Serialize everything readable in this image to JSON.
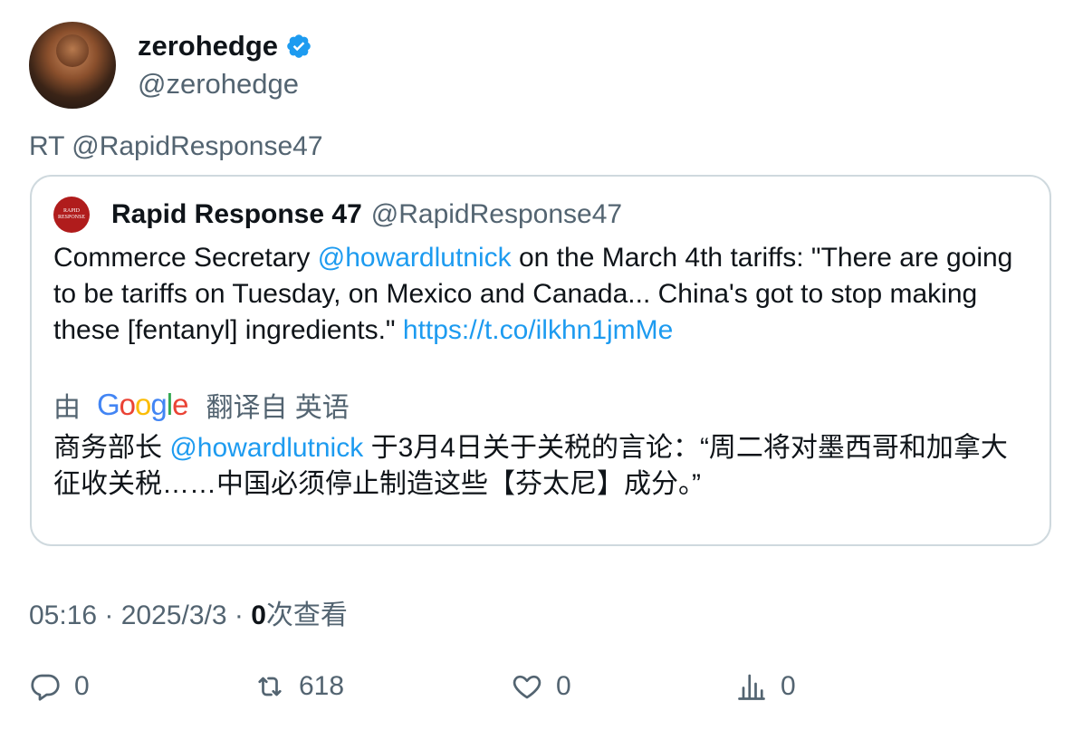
{
  "author": {
    "display_name": "zerohedge",
    "handle": "@zerohedge",
    "verified_icon": "verified-badge-icon"
  },
  "retweet_prefix": "RT @RapidResponse47",
  "quote": {
    "name": "Rapid Response 47",
    "handle": "@RapidResponse47",
    "avatar_text": "RAPID RESPONSE",
    "text_before_mention": "Commerce Secretary ",
    "mention": "@howardlutnick",
    "text_after_mention": " on the March 4th tariffs: \"There are going to be tariffs on Tuesday, on Mexico and Canada... China's got to stop making these [fentanyl] ingredients.\" ",
    "url": "https://t.co/ilkhn1jmMe",
    "translation": {
      "by_label": "由",
      "provider": "Google",
      "translated_from_label": "翻译自 英语",
      "text_before_mention": "商务部长 ",
      "mention": "@howardlutnick",
      "text_after_mention": " 于3月4日关于关税的言论：“周二将对墨西哥和加拿大征收关税……中国必须停止制造这些【芬太尼】成分。”"
    }
  },
  "meta": {
    "time": "05:16",
    "separator": " · ",
    "date": "2025/3/3",
    "views_count": "0",
    "views_label": "次查看"
  },
  "actions": {
    "replies": "0",
    "retweets": "618",
    "likes": "0",
    "views": "0"
  },
  "colors": {
    "link": "#1d9bf0",
    "secondary_text": "#536471",
    "verified": "#1d9bf0"
  }
}
